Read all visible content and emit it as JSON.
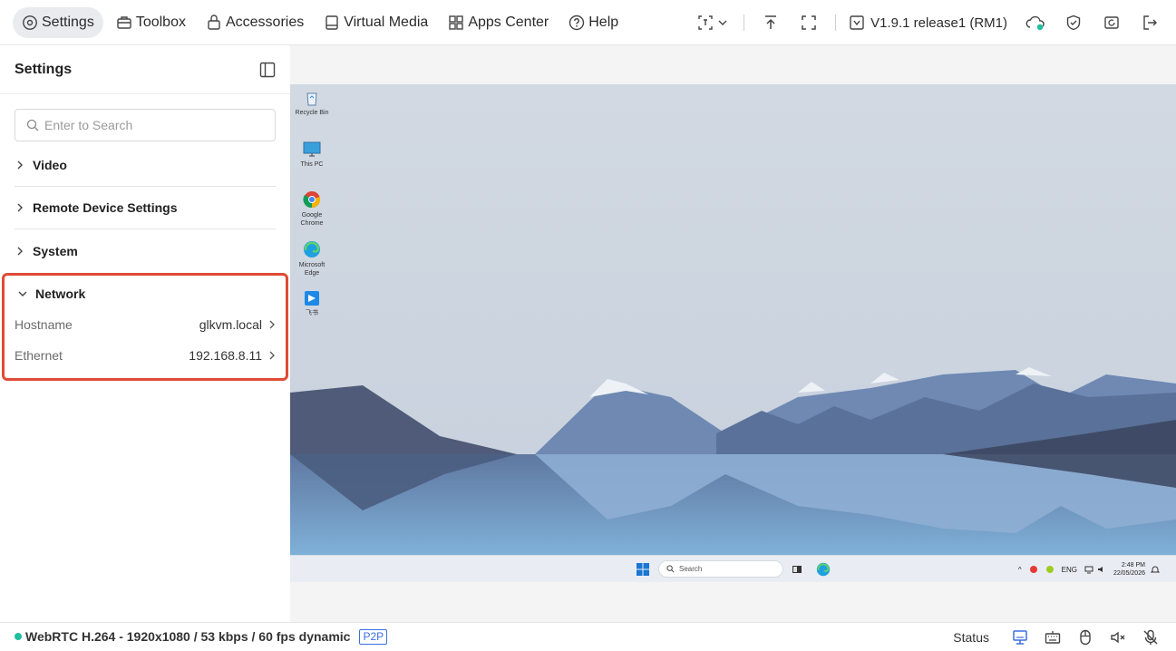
{
  "topbar": {
    "nav": [
      {
        "label": "Settings",
        "icon": "settings-icon"
      },
      {
        "label": "Toolbox",
        "icon": "toolbox-icon"
      },
      {
        "label": "Accessories",
        "icon": "accessories-icon"
      },
      {
        "label": "Virtual Media",
        "icon": "virtual-media-icon"
      },
      {
        "label": "Apps Center",
        "icon": "apps-grid-icon"
      },
      {
        "label": "Help",
        "icon": "help-icon"
      }
    ],
    "version": "V1.9.1 release1 (RM1)"
  },
  "sidebar": {
    "title": "Settings",
    "search_placeholder": "Enter to Search",
    "sections": [
      "Video",
      "Remote Device Settings",
      "System"
    ],
    "network": {
      "title": "Network",
      "rows": [
        {
          "key": "Hostname",
          "value": "glkvm.local"
        },
        {
          "key": "Ethernet",
          "value": "192.168.8.11"
        }
      ]
    }
  },
  "remote_screen": {
    "desktop_icons": [
      "Recycle Bin",
      "This PC",
      "Google Chrome",
      "Microsoft Edge",
      "飞书"
    ],
    "taskbar_search": "Search",
    "tray_lang": "ENG",
    "clock_time": "2:48 PM",
    "clock_date": "22/05/2026"
  },
  "statusbar": {
    "stream": "WebRTC H.264 - 1920x1080 /  53 kbps / 60 fps dynamic",
    "p2p": "P2P",
    "status_label": "Status"
  },
  "colors": {
    "highlight": "#e04b35",
    "online_dot": "#1fbf9f",
    "p2p": "#3b6fe0",
    "active_nav_bg": "#e9ebee"
  }
}
